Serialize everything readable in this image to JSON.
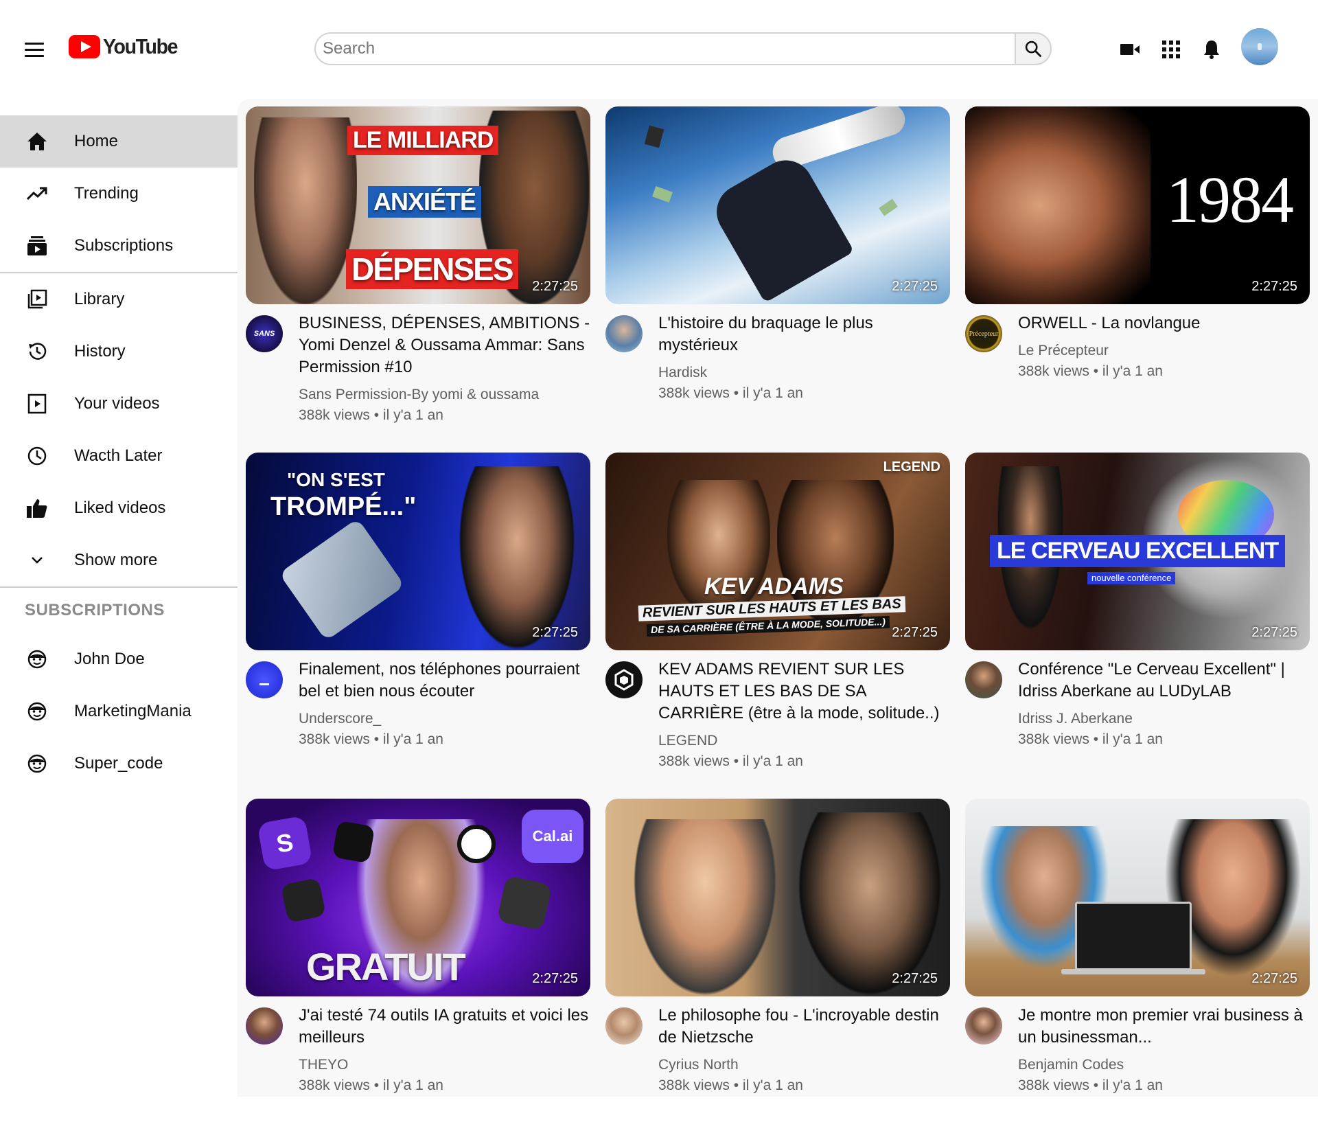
{
  "header": {
    "logo_text": "YouTube",
    "search_placeholder": "Search"
  },
  "sidebar": {
    "items": [
      {
        "label": "Home",
        "icon": "home-icon"
      },
      {
        "label": "Trending",
        "icon": "trending-icon"
      },
      {
        "label": "Subscriptions",
        "icon": "subscriptions-icon"
      },
      {
        "label": "Library",
        "icon": "library-icon"
      },
      {
        "label": "History",
        "icon": "history-icon"
      },
      {
        "label": "Your videos",
        "icon": "your-videos-icon"
      },
      {
        "label": "Wacth Later",
        "icon": "clock-icon"
      },
      {
        "label": "Liked videos",
        "icon": "thumbs-up-icon"
      },
      {
        "label": "Show more",
        "icon": "chevron-down-icon"
      }
    ],
    "subscriptions_heading": "SUBSCRIPTIONS",
    "subscriptions": [
      {
        "label": "John Doe"
      },
      {
        "label": "MarketingMania"
      },
      {
        "label": "Super_code"
      }
    ]
  },
  "videos": [
    {
      "title": "BUSINESS, DÉPENSES, AMBITIONS - Yomi Denzel & Oussama Ammar: Sans Permission #10",
      "channel": "Sans Permission-By yomi & oussama",
      "stats": "388k views • il y'a 1 an",
      "duration": "2:27:25",
      "thumb_text": [
        "LE MILLIARD",
        "ANXIÉTÉ",
        "DÉPENSES"
      ],
      "avatar_text": "SANS"
    },
    {
      "title": "L'histoire du braquage le plus mystérieux",
      "channel": "Hardisk",
      "stats": "388k views • il y'a 1 an",
      "duration": "2:27:25",
      "thumb_text": [],
      "avatar_text": ""
    },
    {
      "title": "ORWELL - La novlangue",
      "channel": "Le Précepteur",
      "stats": "388k views • il y'a 1 an",
      "duration": "2:27:25",
      "thumb_text": [
        "1984"
      ],
      "avatar_text": "Précepteur"
    },
    {
      "title": "Finalement, nos téléphones pourraient bel et bien nous écouter",
      "channel": "Underscore_",
      "stats": "388k views • il y'a 1 an",
      "duration": "2:27:25",
      "thumb_text": [
        "\"ON S'EST",
        "TROMPÉ...\""
      ],
      "avatar_text": ""
    },
    {
      "title": "KEV ADAMS REVIENT SUR LES HAUTS ET LES BAS DE SA CARRIÈRE (être à la mode, solitude..)",
      "channel": "LEGEND",
      "stats": "388k views • il y'a 1 an",
      "duration": "2:27:25",
      "thumb_text": [
        "LEGEND",
        "KEV ADAMS",
        "REVIENT SUR LES HAUTS ET LES BAS",
        "DE SA CARRIÈRE (ÊTRE À LA MODE, SOLITUDE...)"
      ],
      "avatar_text": ""
    },
    {
      "title": "Conférence \"Le Cerveau Excellent\" | Idriss Aberkane au LUDyLAB",
      "channel": "Idriss J. Aberkane",
      "stats": "388k views • il y'a 1 an",
      "duration": "2:27:25",
      "thumb_text": [
        "LE CERVEAU EXCELLENT",
        "nouvelle conférence"
      ],
      "avatar_text": ""
    },
    {
      "title": "J'ai testé 74 outils IA gratuits et voici les meilleurs",
      "channel": "THEYO",
      "stats": "388k views • il y'a 1 an",
      "duration": "2:27:25",
      "thumb_text": [
        "GRATUIT",
        "Cal.ai"
      ],
      "avatar_text": ""
    },
    {
      "title": "Le philosophe fou - L'incroyable destin de Nietzsche",
      "channel": "Cyrius North",
      "stats": "388k views • il y'a 1 an",
      "duration": "2:27:25",
      "thumb_text": [],
      "avatar_text": ""
    },
    {
      "title": "Je montre mon premier vrai business à un businessman...",
      "channel": "Benjamin Codes",
      "stats": "388k views • il y'a 1 an",
      "duration": "2:27:25",
      "thumb_text": [],
      "avatar_text": ""
    }
  ]
}
